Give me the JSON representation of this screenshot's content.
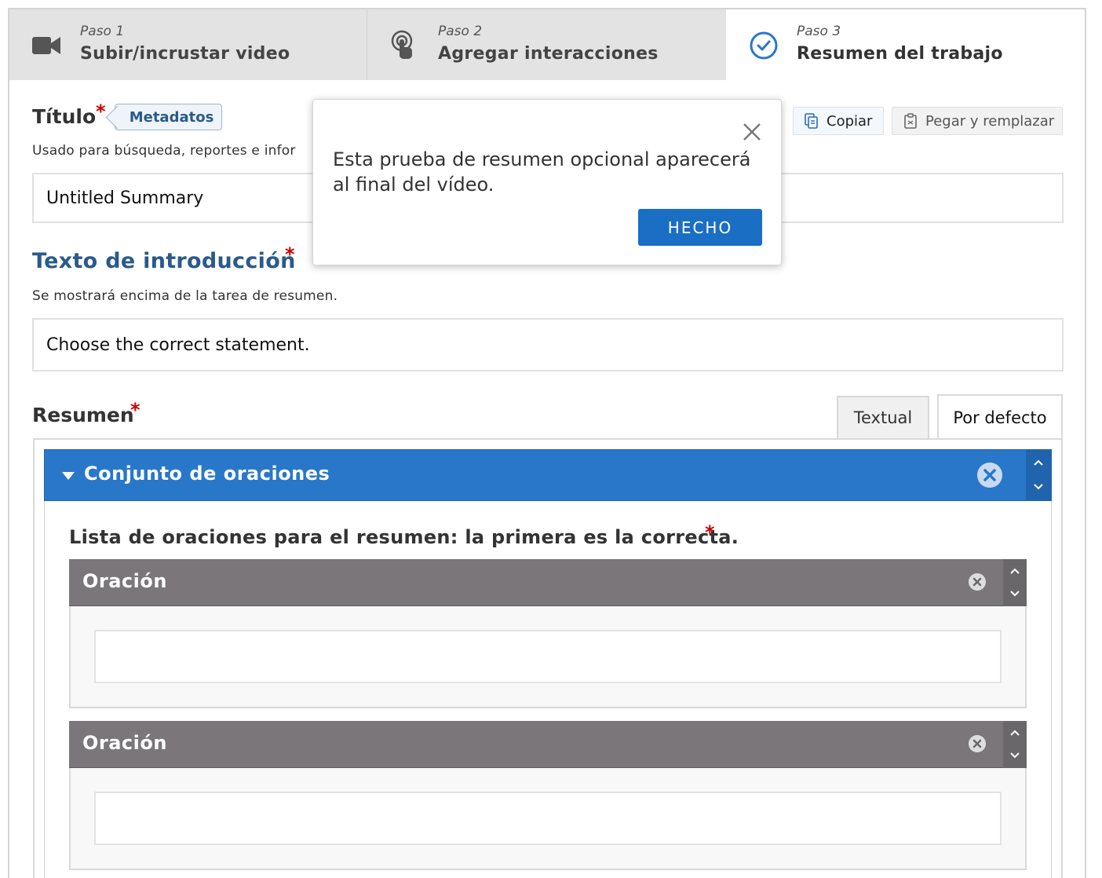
{
  "steps": [
    {
      "num": "Paso 1",
      "label": "Subir/incrustar video",
      "icon": "video-camera-icon"
    },
    {
      "num": "Paso 2",
      "label": "Agregar interacciones",
      "icon": "touch-icon"
    },
    {
      "num": "Paso 3",
      "label": "Resumen del trabajo",
      "icon": "check-circle-icon"
    }
  ],
  "title_field": {
    "label": "Título",
    "required": "*",
    "metadata_button": "Metadatos",
    "description": "Usado para búsqueda, reportes e infor",
    "value": "Untitled Summary"
  },
  "toolbar": {
    "copy_label": "Copiar",
    "paste_label": "Pegar y remplazar"
  },
  "intro_field": {
    "label": "Texto de introducción",
    "required": "*",
    "description": "Se mostrará encima de la tarea de resumen.",
    "value": "Choose the correct statement."
  },
  "summary": {
    "label": "Resumen",
    "required": "*",
    "tabs": [
      "Textual",
      "Por defecto"
    ],
    "active_tab": "Por defecto",
    "group_title": "Conjunto de oraciones",
    "list_label": "Lista de oraciones para el resumen: la primera es la correcta.",
    "list_required": "*",
    "items": [
      {
        "title": "Oración",
        "value": ""
      },
      {
        "title": "Oración",
        "value": ""
      }
    ]
  },
  "modal": {
    "message": "Esta prueba de resumen opcional aparecerá al final del vídeo.",
    "done_label": "HECHO"
  },
  "colors": {
    "accent": "#2977c9",
    "item_header": "#7a767a",
    "required": "#cc0000",
    "done_button": "#1a6ec4"
  }
}
